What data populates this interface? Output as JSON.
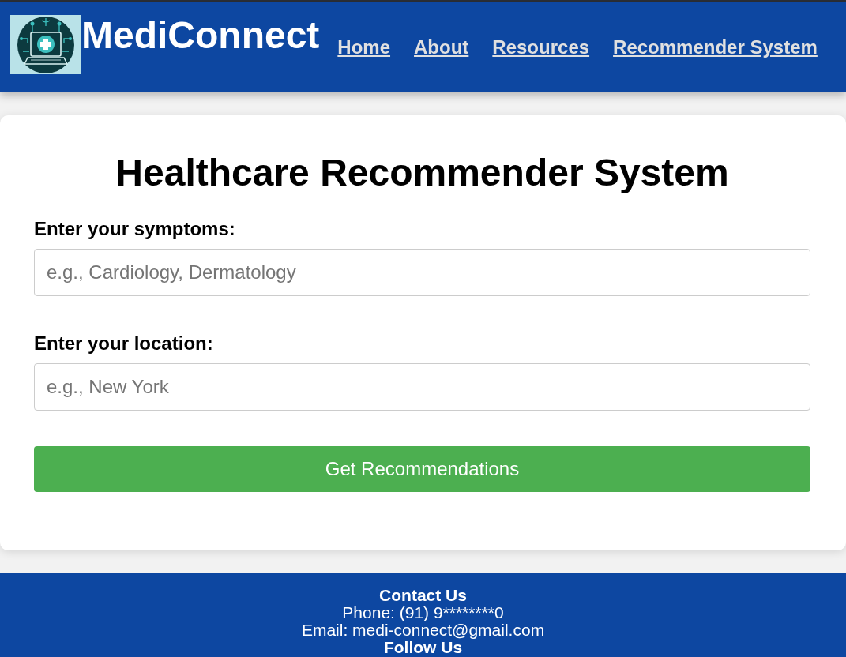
{
  "header": {
    "brand": "MediConnect",
    "nav": [
      {
        "label": "Home"
      },
      {
        "label": "About"
      },
      {
        "label": "Resources"
      },
      {
        "label": "Recommender System"
      }
    ]
  },
  "card": {
    "title": "Healthcare Recommender System",
    "fields": [
      {
        "label": "Enter your symptoms:",
        "placeholder": "e.g., Cardiology, Dermatology"
      },
      {
        "label": "Enter your location:",
        "placeholder": "e.g., New York"
      }
    ],
    "button": "Get Recommendations"
  },
  "footer": {
    "heading": "Contact Us",
    "lines": [
      "Phone: (91) 9********0",
      "Email: medi-connect@gmail.com"
    ],
    "heading_2": "Follow Us"
  }
}
